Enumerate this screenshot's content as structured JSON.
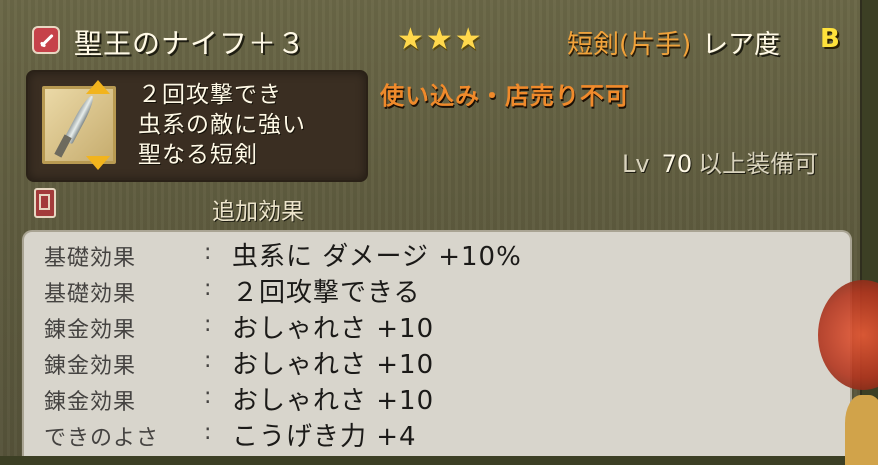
{
  "header": {
    "item_name": "聖王のナイフ＋３",
    "stars": "★★★",
    "weapon_type": "短剣(片手)",
    "rarity_label": "レア度",
    "rarity_grade": "B"
  },
  "description": {
    "lines": [
      "２回攻撃でき",
      "虫系の敵に強い",
      "聖なる短剣"
    ]
  },
  "warning": "使い込み・店売り不可",
  "level": {
    "prefix": "Lv",
    "value": "70",
    "suffix": "以上装備可"
  },
  "extra_effects": {
    "label": "追加効果",
    "rows": [
      {
        "key": "基礎効果",
        "colon": ":",
        "value": "虫系に ダメージ +10%"
      },
      {
        "key": "基礎効果",
        "colon": ":",
        "value": "２回攻撃できる"
      },
      {
        "key": "錬金効果",
        "colon": ":",
        "value": "おしゃれさ +10"
      },
      {
        "key": "錬金効果",
        "colon": ":",
        "value": "おしゃれさ +10"
      },
      {
        "key": "錬金効果",
        "colon": ":",
        "value": "おしゃれさ +10"
      },
      {
        "key": "できのよさ",
        "colon": ":",
        "value": "こうげき力 +4"
      }
    ]
  },
  "colors": {
    "star": "#ffd84c",
    "weapon_type": "#f1a23a",
    "warning": "#f08a2b",
    "rarity_grade": "#ffe23b"
  },
  "icons": {
    "weapon_category": "dagger-icon",
    "item": "knife-item-icon",
    "extra_effects": "book-icon"
  }
}
